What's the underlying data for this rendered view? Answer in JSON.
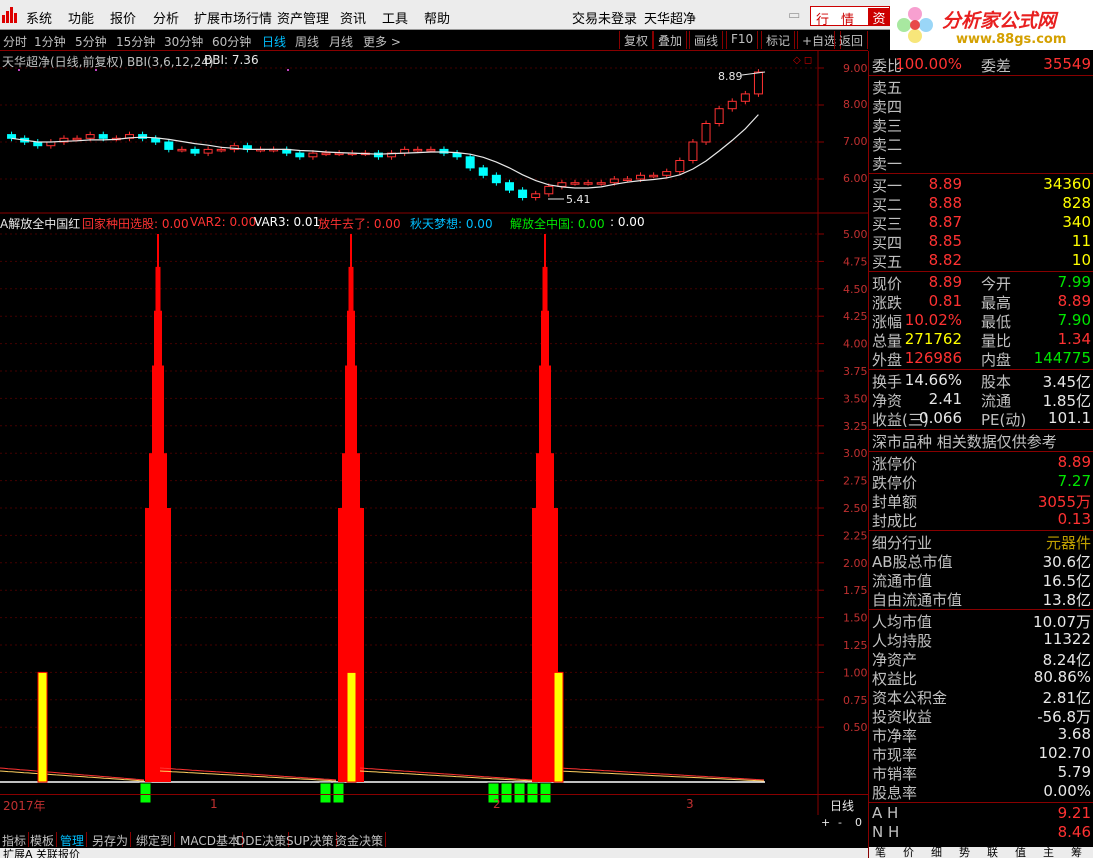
{
  "menubar": {
    "items": [
      "系统",
      "功能",
      "报价",
      "分析",
      "扩展市场行情",
      "资产管理",
      "资讯",
      "工具",
      "帮助"
    ],
    "login_status": "交易未登录",
    "stock_name": "天华超净",
    "right_buttons": [
      "行",
      "情",
      "资"
    ],
    "watermark_title": "分析家公式网",
    "watermark_url": "www.88gs.com"
  },
  "periods": {
    "items": [
      "分时",
      "1分钟",
      "5分钟",
      "15分钟",
      "30分钟",
      "60分钟",
      "日线",
      "周线",
      "月线",
      "更多 >"
    ],
    "active": "日线"
  },
  "toolbar": {
    "buttons": [
      "复权",
      "叠加",
      "画线",
      "F10",
      "标记",
      "+自选",
      "返回"
    ]
  },
  "main_chart": {
    "header": "天华超净(日线,前复权) BBI(3,6,12,24)",
    "bbi_label": "BBI: 7.36",
    "high_label": "8.89",
    "low_label": "5.41",
    "y_ticks": [
      "9.00",
      "8.00",
      "7.00",
      "6.00"
    ]
  },
  "indicator": {
    "name": "A解放全中国红",
    "values": [
      {
        "text": "回家种田选股: 0.00",
        "color": "#ff3232"
      },
      {
        "text": "VAR2: 0.00",
        "color": "#ff3232"
      },
      {
        "text": "VAR3: 0.01",
        "color": "#ffffff"
      },
      {
        "text": "放牛去了: 0.00",
        "color": "#ff3232"
      },
      {
        "text": "秋天梦想: 0.00",
        "color": "#00bfff"
      },
      {
        "text": "解放全中国: 0.00",
        "color": "#00e600"
      },
      {
        "text": ": 0.00",
        "color": "#ffffff"
      }
    ],
    "y_ticks": [
      "5.00",
      "4.75",
      "4.50",
      "4.25",
      "4.00",
      "3.75",
      "3.50",
      "3.25",
      "3.00",
      "2.75",
      "2.50",
      "2.25",
      "2.00",
      "1.75",
      "1.50",
      "1.25",
      "1.00",
      "0.75",
      "0.50"
    ]
  },
  "chart_data": {
    "type": "bar",
    "title": "A解放全中国红",
    "ylim": [
      0,
      5.25
    ],
    "signals": [
      {
        "name": "red_column",
        "color": "#ff0000",
        "positions": [
          158,
          351,
          545
        ],
        "heights": [
          5.0,
          5.0,
          5.0
        ]
      },
      {
        "name": "yellow_bar",
        "color": "#ffff00",
        "positions": [
          42,
          351,
          558
        ],
        "heights": [
          1.0,
          1.0,
          1.0
        ]
      },
      {
        "name": "green_block",
        "color": "#00ff00",
        "positions": [
          145,
          325,
          338,
          493,
          506,
          519,
          532,
          545
        ],
        "heights": [
          0.15,
          0.15,
          0.15,
          0.15,
          0.15,
          0.15,
          0.15,
          0.15
        ]
      }
    ],
    "candles": {
      "opens": [
        7.2,
        7.1,
        7.0,
        6.9,
        7.0,
        7.1,
        7.1,
        7.2,
        7.1,
        7.1,
        7.2,
        7.1,
        7.0,
        6.8,
        6.8,
        6.7,
        6.8,
        6.8,
        6.9,
        6.8,
        6.8,
        6.8,
        6.7,
        6.6,
        6.7,
        6.7,
        6.7,
        6.7,
        6.7,
        6.6,
        6.7,
        6.8,
        6.8,
        6.8,
        6.7,
        6.6,
        6.3,
        6.1,
        5.9,
        5.7,
        5.5,
        5.6,
        5.8,
        5.9,
        5.9,
        5.9,
        5.9,
        6.0,
        6.0,
        6.1,
        6.1,
        6.2,
        6.5,
        7.0,
        7.5,
        7.9,
        8.1,
        8.3
      ],
      "closes": [
        7.1,
        7.0,
        6.9,
        7.0,
        7.1,
        7.1,
        7.2,
        7.1,
        7.1,
        7.2,
        7.1,
        7.0,
        6.8,
        6.8,
        6.7,
        6.8,
        6.8,
        6.9,
        6.8,
        6.8,
        6.8,
        6.7,
        6.6,
        6.7,
        6.7,
        6.7,
        6.7,
        6.7,
        6.6,
        6.7,
        6.8,
        6.8,
        6.8,
        6.7,
        6.6,
        6.3,
        6.1,
        5.9,
        5.7,
        5.5,
        5.6,
        5.8,
        5.9,
        5.9,
        5.9,
        5.9,
        6.0,
        6.0,
        6.1,
        6.1,
        6.2,
        6.5,
        7.0,
        7.5,
        7.9,
        8.1,
        8.3,
        8.89
      ]
    }
  },
  "x_axis": {
    "labels": [
      "2017年",
      "1",
      "2",
      "3"
    ],
    "period_label": "日线",
    "buttons": [
      "+",
      "-",
      "0"
    ]
  },
  "bottom_tabs": {
    "items": [
      "指标",
      "模板",
      "管理",
      "另存为",
      "绑定到",
      "MACD基本",
      "DDE决策",
      "SUP决策",
      "资金决策"
    ],
    "active": "管理"
  },
  "status_bar": {
    "text": "扩展A 关联报价"
  },
  "quote": {
    "weibi": {
      "label": "委比",
      "value": "100.00%",
      "label2": "委差",
      "value2": "35549"
    },
    "sells": [
      {
        "label": "卖五",
        "price": "",
        "vol": ""
      },
      {
        "label": "卖四",
        "price": "",
        "vol": ""
      },
      {
        "label": "卖三",
        "price": "",
        "vol": ""
      },
      {
        "label": "卖二",
        "price": "",
        "vol": ""
      },
      {
        "label": "卖一",
        "price": "",
        "vol": ""
      }
    ],
    "buys": [
      {
        "label": "买一",
        "price": "8.89",
        "vol": "34360"
      },
      {
        "label": "买二",
        "price": "8.88",
        "vol": "828"
      },
      {
        "label": "买三",
        "price": "8.87",
        "vol": "340"
      },
      {
        "label": "买四",
        "price": "8.85",
        "vol": "11"
      },
      {
        "label": "买五",
        "price": "8.82",
        "vol": "10"
      }
    ],
    "stats": [
      {
        "l": "现价",
        "v": "8.89",
        "vc": "#ff3232",
        "l2": "今开",
        "v2": "7.99",
        "v2c": "#00e600"
      },
      {
        "l": "涨跌",
        "v": "0.81",
        "vc": "#ff3232",
        "l2": "最高",
        "v2": "8.89",
        "v2c": "#ff3232"
      },
      {
        "l": "涨幅",
        "v": "10.02%",
        "vc": "#ff3232",
        "l2": "最低",
        "v2": "7.90",
        "v2c": "#00e600"
      },
      {
        "l": "总量",
        "v": "271762",
        "vc": "#ffff00",
        "l2": "量比",
        "v2": "1.34",
        "v2c": "#ff3232"
      },
      {
        "l": "外盘",
        "v": "126986",
        "vc": "#ff3232",
        "l2": "内盘",
        "v2": "144775",
        "v2c": "#00e600"
      }
    ],
    "finance": [
      {
        "l": "换手",
        "v": "14.66%",
        "l2": "股本",
        "v2": "3.45亿"
      },
      {
        "l": "净资",
        "v": "2.41",
        "l2": "流通",
        "v2": "1.85亿"
      },
      {
        "l": "收益(三)",
        "v": "0.066",
        "l2": "PE(动)",
        "v2": "101.1"
      }
    ],
    "market_note": "深市品种  相关数据仅供参考",
    "limits": [
      {
        "l": "涨停价",
        "v": "8.89",
        "c": "#ff3232"
      },
      {
        "l": "跌停价",
        "v": "7.27",
        "c": "#00e600"
      },
      {
        "l": "封单额",
        "v": "3055万",
        "c": "#ff3232"
      },
      {
        "l": "封成比",
        "v": "0.13",
        "c": "#ff3232"
      }
    ],
    "industry": [
      {
        "l": "细分行业",
        "v": "元器件",
        "c": "#c0a000"
      },
      {
        "l": "AB股总市值",
        "v": "30.6亿",
        "c": "#e8e8e8"
      },
      {
        "l": "流通市值",
        "v": "16.5亿",
        "c": "#e8e8e8"
      },
      {
        "l": "自由流通市值",
        "v": "13.8亿",
        "c": "#e8e8e8"
      }
    ],
    "per_share": [
      {
        "l": "人均市值",
        "v": "10.07万",
        "c": "#e8e8e8"
      },
      {
        "l": "人均持股",
        "v": "11322",
        "c": "#e8e8e8"
      },
      {
        "l": "净资产",
        "v": "8.24亿",
        "c": "#e8e8e8"
      },
      {
        "l": "权益比",
        "v": "80.86%",
        "c": "#e8e8e8"
      },
      {
        "l": "资本公积金",
        "v": "2.81亿",
        "c": "#e8e8e8"
      },
      {
        "l": "投资收益",
        "v": "-56.8万",
        "c": "#e8e8e8"
      },
      {
        "l": "市净率",
        "v": "3.68",
        "c": "#e8e8e8"
      },
      {
        "l": "市现率",
        "v": "102.70",
        "c": "#e8e8e8"
      },
      {
        "l": "市销率",
        "v": "5.79",
        "c": "#e8e8e8"
      },
      {
        "l": "股息率",
        "v": "0.00%",
        "c": "#e8e8e8"
      }
    ],
    "ah": [
      {
        "l": "A H",
        "v": "9.21",
        "c": "#ff3232"
      },
      {
        "l": "N H",
        "v": "8.46",
        "c": "#ff3232"
      }
    ],
    "bottom_tabs": [
      "笔",
      "价",
      "细",
      "势",
      "联",
      "值",
      "主",
      "筹"
    ]
  }
}
